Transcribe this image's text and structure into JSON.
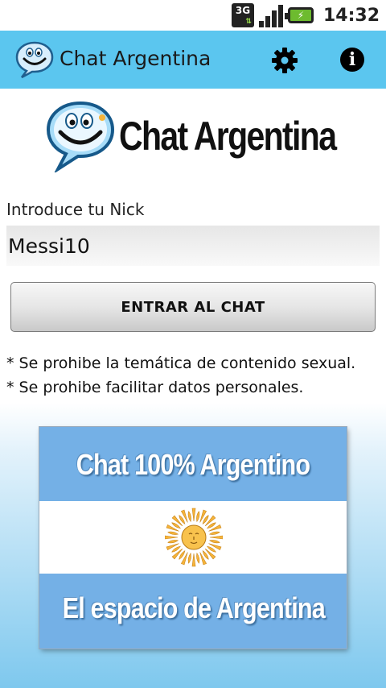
{
  "status_bar": {
    "network": "3G",
    "time": "14:32"
  },
  "action_bar": {
    "title": "Chat Argentina",
    "settings_icon": "gear-icon",
    "info_icon": "info-icon"
  },
  "header": {
    "logo_text": "Chat Argentina"
  },
  "form": {
    "nick_label": "Introduce tu Nick",
    "nick_value": "Messi10",
    "enter_button": "ENTRAR AL CHAT"
  },
  "rules": [
    "* Se prohibe la temática de contenido sexual.",
    "* Se prohibe facilitar datos personales."
  ],
  "banner": {
    "top_text": "Chat 100% Argentino",
    "bottom_text": "El espacio de Argentina"
  },
  "colors": {
    "action_bar": "#5bc6ef",
    "flag_blue": "#74b0e6",
    "sun": "#f6b43a"
  }
}
